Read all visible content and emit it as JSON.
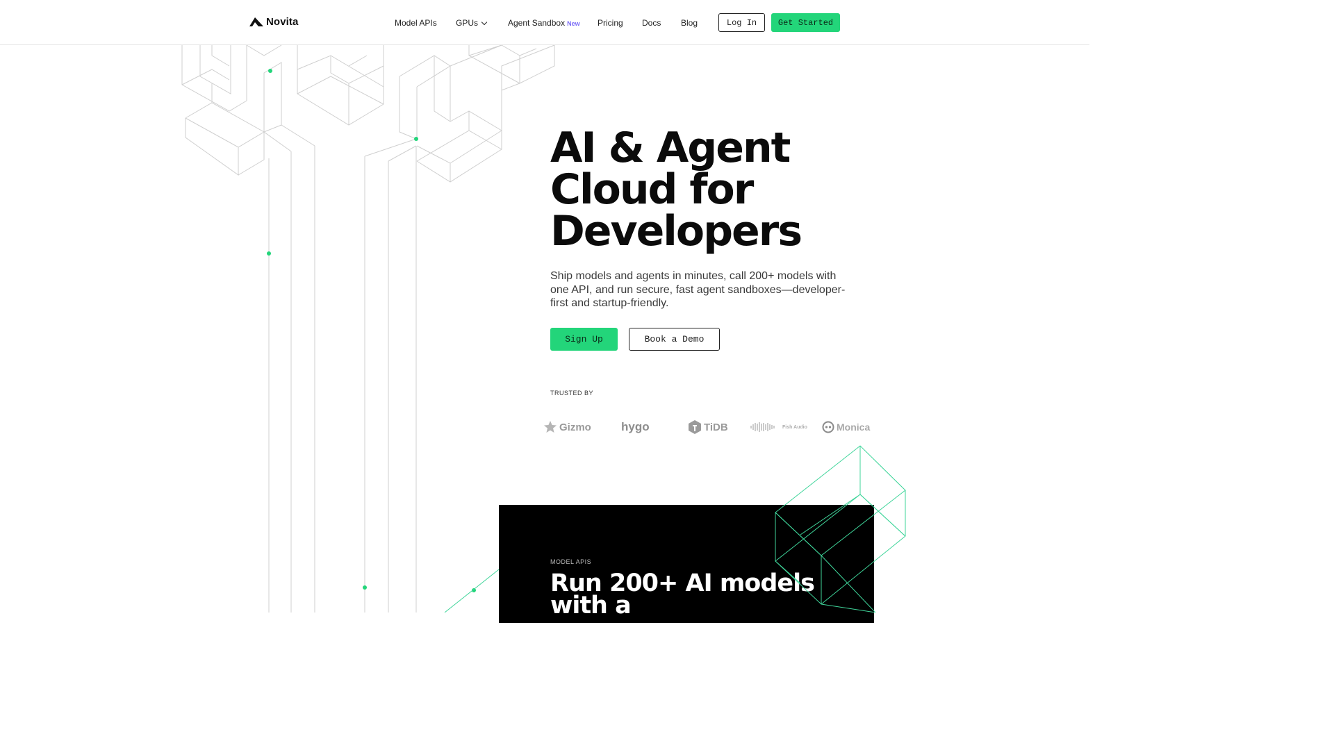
{
  "nav": {
    "brand": "Novita",
    "links": [
      {
        "label": "Model APIs"
      },
      {
        "label": "GPUs"
      },
      {
        "label": "Agent Sandbox",
        "badge": "New"
      },
      {
        "label": "Pricing"
      },
      {
        "label": "Docs"
      },
      {
        "label": "Blog"
      }
    ],
    "login_label": "Log In",
    "get_started_label": "Get Started"
  },
  "hero": {
    "title_lines": [
      "AI & Agent",
      "Cloud for",
      "Developers"
    ],
    "subtitle": "Ship models and agents in minutes, call 200+ models with one API, and run secure, fast agent sandboxes—developer-first and startup-friendly.",
    "signup_label": "Sign Up",
    "demo_label": "Book a Demo"
  },
  "trusted": {
    "label": "TRUSTED BY",
    "brands": [
      "Gizmo",
      "hygo",
      "TiDB",
      "Fish Audio",
      "Monica"
    ]
  },
  "card": {
    "label": "MODEL APIS",
    "title": "Run 200+ AI models with a"
  },
  "colors": {
    "accent": "#23d57a",
    "badge": "#7b6cf6",
    "line_gray": "#cfcfcf",
    "line_green": "#3fd59a"
  }
}
